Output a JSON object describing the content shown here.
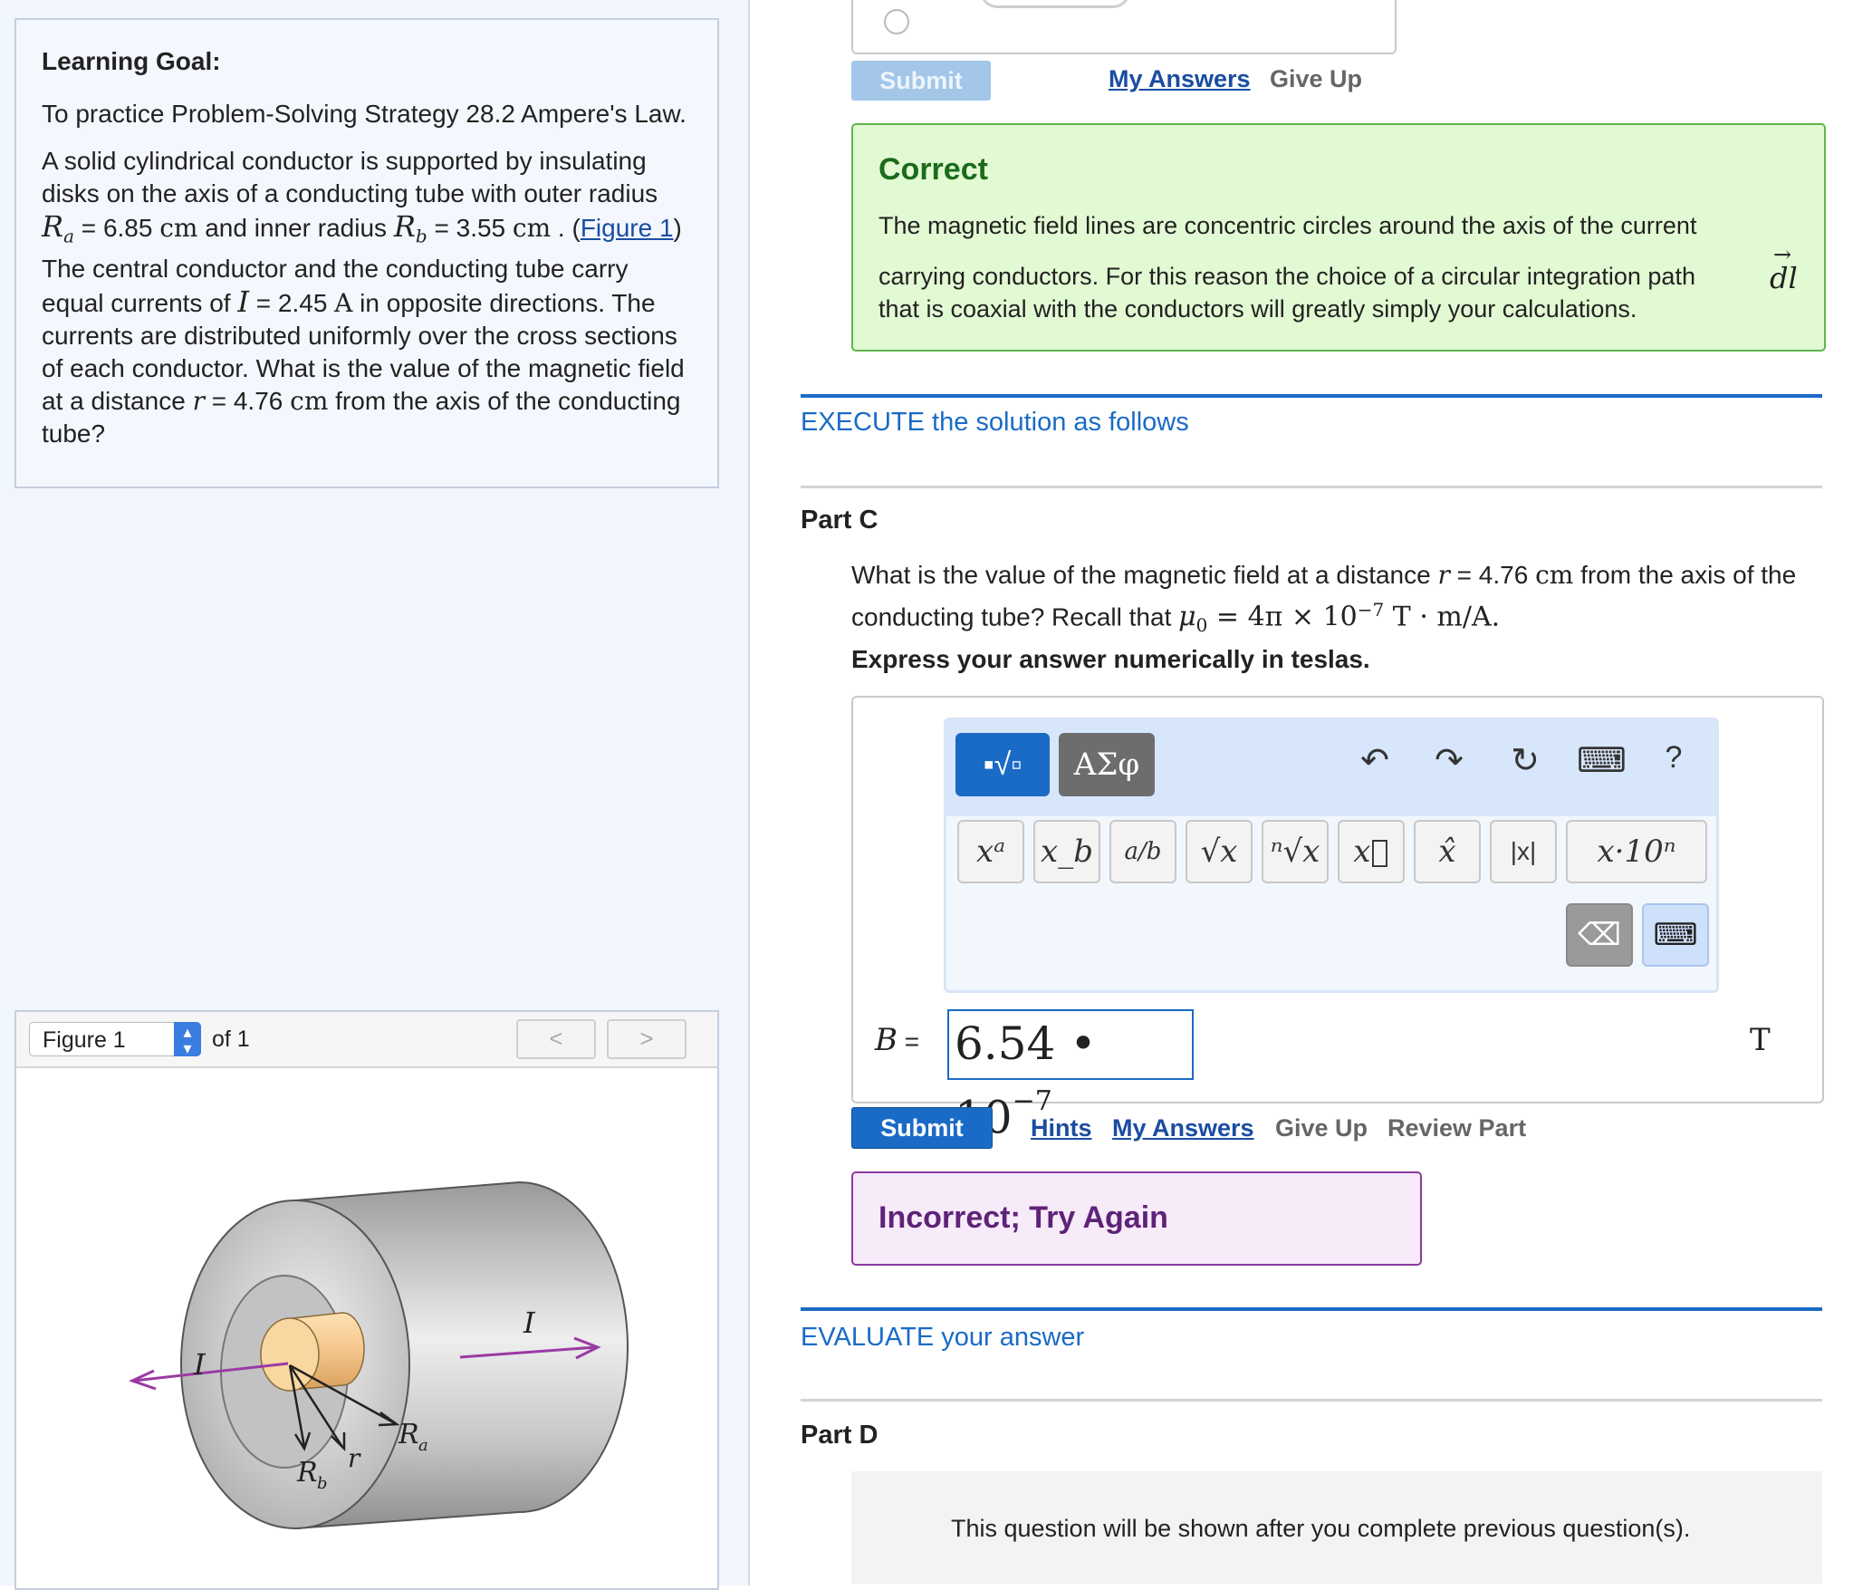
{
  "goal": {
    "heading": "Learning Goal:",
    "intro": "To practice Problem-Solving Strategy 28.2 Ampere's Law.",
    "para_a": "A solid cylindrical conductor is supported by insulating disks on the axis of a conducting tube with outer radius",
    "Ra_sym": "R",
    "Ra_sub": "a",
    "Ra_text": " = 6.85 ",
    "Ra_unit": "cm",
    "and_inner": " and inner radius ",
    "Rb_sym": "R",
    "Rb_sub": "b",
    "Rb_text": " = 3.55 ",
    "Rb_unit": "cm",
    "dot": " .",
    "open_paren": "(",
    "figure_link": "Figure 1",
    "para_b": ") The central conductor and the conducting tube carry equal currents of ",
    "I_sym": "I",
    "I_text": " = 2.45 ",
    "I_unit": "A",
    "para_c": " in opposite directions. The currents are distributed uniformly over the cross sections of each conductor. What is the value of the magnetic field at a distance ",
    "r_sym": "r",
    "r_text": " = 4.76 ",
    "r_unit": "cm",
    "para_d": " from the axis of the conducting tube?"
  },
  "figure": {
    "select_label": "Figure 1",
    "of_label": "of 1",
    "prev": "<",
    "next": ">",
    "label_I_left": "I",
    "label_I_right": "I",
    "label_Rb": "R",
    "label_Rb_sub": "b",
    "label_r": "r",
    "label_Ra": "R",
    "label_Ra_sub": "a"
  },
  "partB": {
    "submit": "Submit",
    "my_answers": "My Answers",
    "give_up": "Give Up",
    "correct_title": "Correct",
    "correct_line1": "The magnetic field lines are concentric circles around the axis of the current",
    "correct_line2": "carrying conductors. For this reason the choice of a circular integration path",
    "dl": "dl",
    "correct_line3": "that is coaxial with the conductors will greatly simply your calculations."
  },
  "execute_heading": "EXECUTE the solution as follows",
  "partC": {
    "title": "Part C",
    "question_a": "What is the value of the magnetic field at a distance ",
    "r_sym": "r",
    "question_b": " = 4.76 ",
    "r_unit": "cm",
    "question_c": " from the axis of the",
    "question_d": "conducting tube? Recall that ",
    "mu": "μ",
    "mu_sub": "0",
    "mu_eq": " = 4π × 10",
    "mu_exp": "−7",
    "mu_unit": " T · m/A.",
    "instruction": "Express your answer numerically in teslas.",
    "toolbar": {
      "template_mode": "▪√▫",
      "greek_mode": "ΑΣφ",
      "undo": "↶",
      "redo": "↷",
      "reset": "↻",
      "keyboard": "⌨",
      "help": "?",
      "keys": [
        "xᵃ",
        "x_b",
        "a/b",
        "√x",
        "ⁿ√x",
        "x⃗",
        "x̂",
        "|x|",
        "x·10ⁿ"
      ],
      "backspace": "⌫",
      "kbd_toggle": "⌨"
    },
    "var_label": "B",
    "equals": " =",
    "answer_mantissa": "6.54 • 10",
    "answer_exp": "−7",
    "unit": "T",
    "submit": "Submit",
    "hints": "Hints",
    "my_answers": "My Answers",
    "give_up": "Give Up",
    "review": "Review Part",
    "feedback": "Incorrect; Try Again"
  },
  "evaluate_heading": "EVALUATE your answer",
  "partD": {
    "title": "Part D",
    "locked_text": "This question will be shown after you complete previous question(s)."
  },
  "colors": {
    "accent_blue": "#1a6bc6",
    "correct_green": "#e2fad3",
    "incorrect_purple": "#f7eaf9",
    "field_arrow": "#9b3aa3"
  }
}
